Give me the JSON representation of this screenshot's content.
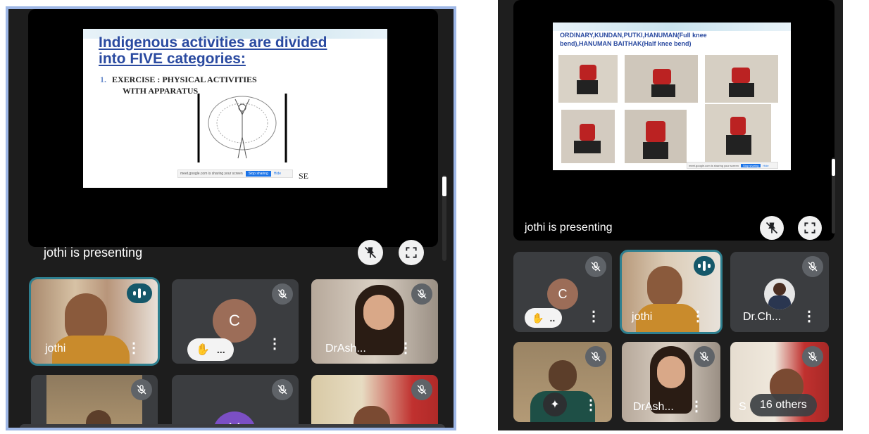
{
  "left": {
    "slide": {
      "title_line1": "Indigenous activities are divided",
      "title_line2": "into FIVE categories:",
      "list_number": "1.",
      "item_line1": "EXERCISE : PHYSICAL ACTIVITIES",
      "item_line2": "WITH APPARATUS",
      "share_notice": "meet.google.com is sharing your screen",
      "stop_sharing": "Stop sharing",
      "hide": "Hide",
      "cut_text": "SE"
    },
    "presenting_label": "jothi is presenting",
    "tiles": [
      {
        "name": "jothi"
      },
      {
        "avatar_letter": "C",
        "raise_dots": "..."
      },
      {
        "name": "DrAsh..."
      },
      {
        "name": ""
      },
      {
        "avatar_letter": "V"
      },
      {
        "name": ""
      }
    ]
  },
  "right": {
    "slide": {
      "caption_line1": "ORDINARY,KUNDAN,PUTKI,HANUMAN(Full knee",
      "caption_line2": "bend),HANUMAN BAITHAK(Half knee bend)",
      "share_notice": "meet.google.com is sharing your screen",
      "stop_sharing": "Stop sharing",
      "hide": "Hide"
    },
    "presenting_label": "jothi is presenting",
    "tiles": [
      {
        "avatar_letter": "C",
        "raise_dots": ".."
      },
      {
        "name": "jothi"
      },
      {
        "name": "Dr.Ch..."
      },
      {
        "name": ""
      },
      {
        "name": "DrAsh..."
      },
      {
        "name": "S",
        "others": "16 others"
      }
    ]
  },
  "colors": {
    "accent_teal": "#2e7f8f",
    "avatar_c": "#9c6d58",
    "avatar_v": "#7b4fc4",
    "left_border": "#9eb7e6"
  },
  "icons": [
    "unpin-icon",
    "fullscreen-icon",
    "mic-off-icon",
    "speaking-icon",
    "raise-hand-icon",
    "more-vert-icon",
    "effects-icon"
  ]
}
